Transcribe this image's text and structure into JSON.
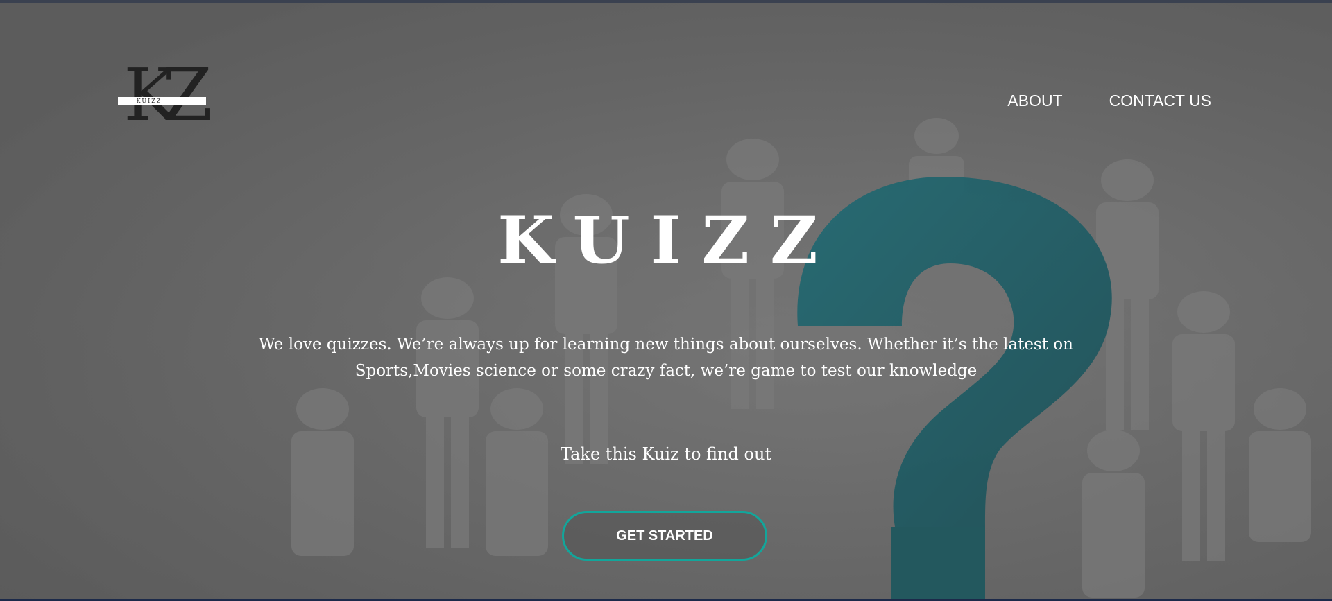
{
  "logo": {
    "letters": "KZ",
    "word": "KUIZZ"
  },
  "nav": {
    "about": "ABOUT",
    "contact": "CONTACT US"
  },
  "hero": {
    "title": "KUIZZ",
    "description": "We love quizzes. We’re always up for learning new things about ourselves. Whether it’s the latest on Sports,Movies science or some crazy fact, we’re game to test our knowledge",
    "cta_text": "Take this Kuiz to find out",
    "button_label": "GET STARTED"
  },
  "colors": {
    "accent": "#12a69b",
    "question_mark": "#0f6f7a",
    "top_bar": "#3a4150",
    "bottom_bar": "#1c2a4a"
  }
}
